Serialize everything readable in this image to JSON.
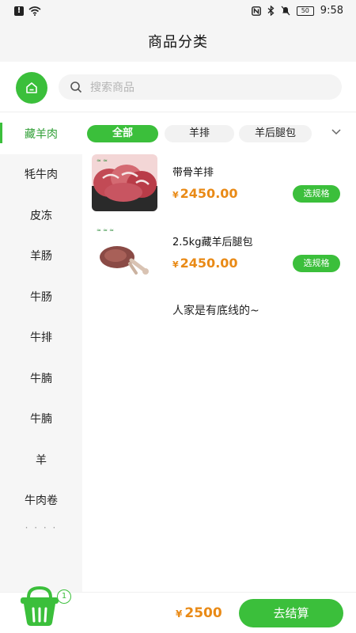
{
  "status_bar": {
    "time": "9:58",
    "battery": "50"
  },
  "header": {
    "title": "商品分类"
  },
  "search": {
    "placeholder": "搜索商品"
  },
  "sidebar": {
    "items": [
      "藏羊肉",
      "牦牛肉",
      "皮冻",
      "羊肠",
      "牛肠",
      "牛排",
      "牛腩",
      "牛腩",
      "羊",
      "牛肉卷"
    ],
    "active_index": 0
  },
  "tabs": {
    "items": [
      "全部",
      "羊排",
      "羊后腿包"
    ],
    "active_index": 0
  },
  "products": [
    {
      "name": "带骨羊排",
      "currency": "¥",
      "price": "2450.00",
      "button": "选规格",
      "image": "lamb-ribs-photo"
    },
    {
      "name": "2.5kg藏羊后腿包",
      "currency": "¥",
      "price": "2450.00",
      "button": "选规格",
      "image": "lamb-leg-photo"
    }
  ],
  "end_text": "人家是有底线的~",
  "bottom": {
    "cart_count": "1",
    "currency": "¥",
    "total": "2500",
    "checkout_label": "去结算"
  },
  "colors": {
    "accent": "#3bbf3b",
    "price": "#e98a16"
  }
}
